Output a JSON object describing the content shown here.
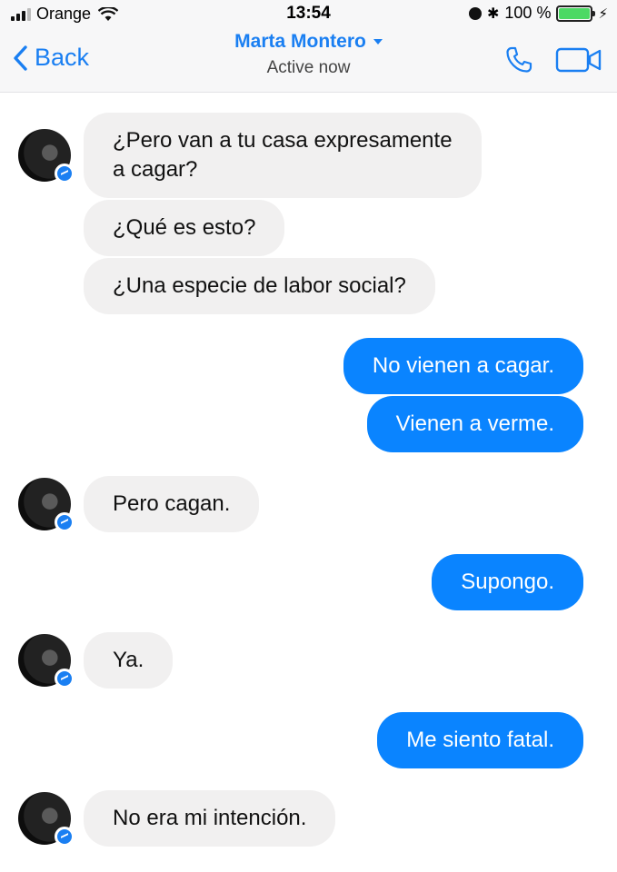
{
  "status_bar": {
    "carrier": "Orange",
    "time": "13:54",
    "battery_percent": "100 %",
    "battery_level": 1.0
  },
  "header": {
    "back_label": "Back",
    "contact_name": "Marta Montero",
    "contact_status": "Active now"
  },
  "icons": {
    "back": "chevron-left-icon",
    "call": "phone-icon",
    "video": "video-camera-icon",
    "messenger_badge": "messenger-icon"
  },
  "colors": {
    "accent": "#1a7ff2",
    "outgoing_bubble": "#0a84ff",
    "incoming_bubble": "#f1f0f0"
  },
  "messages": [
    {
      "sender": "contact",
      "text": "¿Pero van a tu casa expresamente\na cagar?"
    },
    {
      "sender": "contact",
      "text": "¿Qué es esto?"
    },
    {
      "sender": "contact",
      "text": "¿Una especie de labor social?"
    },
    {
      "sender": "me",
      "text": "No vienen a cagar."
    },
    {
      "sender": "me",
      "text": "Vienen a verme."
    },
    {
      "sender": "contact",
      "text": "Pero cagan."
    },
    {
      "sender": "me",
      "text": "Supongo."
    },
    {
      "sender": "contact",
      "text": "Ya."
    },
    {
      "sender": "me",
      "text": "Me siento fatal."
    },
    {
      "sender": "contact",
      "text": "No era mi intención."
    }
  ]
}
